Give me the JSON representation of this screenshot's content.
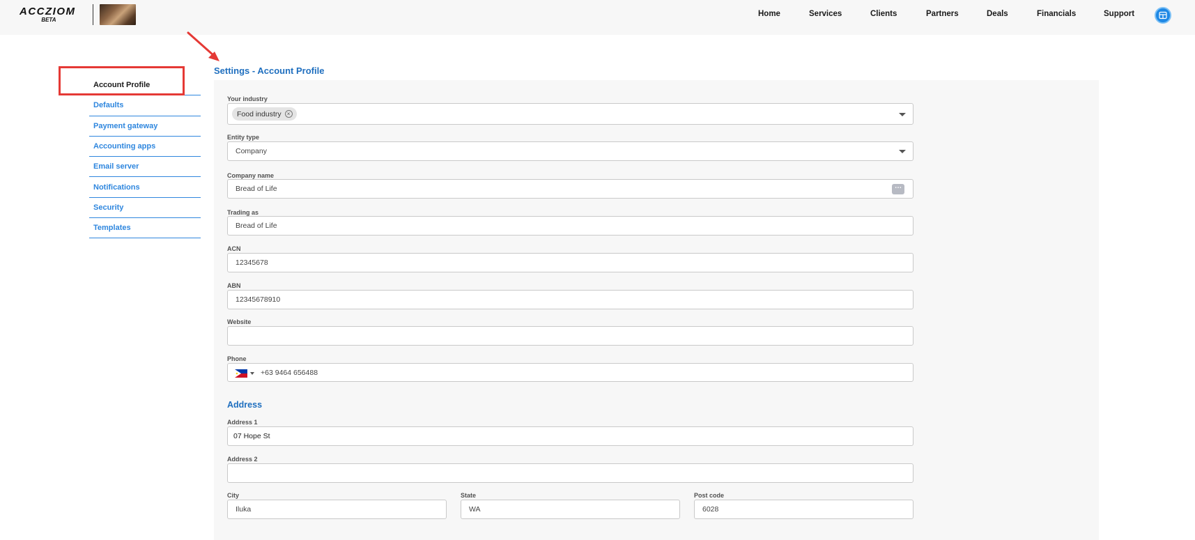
{
  "brand": {
    "name": "ACCZIOM",
    "badge": "BETA"
  },
  "nav": {
    "items": [
      "Home",
      "Services",
      "Clients",
      "Partners",
      "Deals",
      "Financials",
      "Support"
    ]
  },
  "sidebar": {
    "items": [
      {
        "label": "Account Profile",
        "active": true
      },
      {
        "label": "Defaults"
      },
      {
        "label": "Payment gateway"
      },
      {
        "label": "Accounting apps"
      },
      {
        "label": "Email server"
      },
      {
        "label": "Notifications"
      },
      {
        "label": "Security"
      },
      {
        "label": "Templates"
      }
    ]
  },
  "page": {
    "title": "Settings - Account Profile"
  },
  "form": {
    "industry": {
      "label": "Your industry",
      "chip": "Food industry"
    },
    "entity_type": {
      "label": "Entity type",
      "value": "Company"
    },
    "company_name": {
      "label": "Company name",
      "value": "Bread of Life",
      "action": "⋯"
    },
    "trading_as": {
      "label": "Trading as",
      "value": "Bread of Life"
    },
    "acn": {
      "label": "ACN",
      "value": "12345678"
    },
    "abn": {
      "label": "ABN",
      "value": "12345678910"
    },
    "website": {
      "label": "Website",
      "value": ""
    },
    "phone": {
      "label": "Phone",
      "value": "+63 9464 656488",
      "country_flag": "flag-philippines"
    }
  },
  "address": {
    "title": "Address",
    "address1": {
      "label": "Address 1",
      "value": "07 Hope St"
    },
    "address2": {
      "label": "Address 2",
      "value": ""
    },
    "city": {
      "label": "City",
      "value": "Iluka"
    },
    "state": {
      "label": "State",
      "value": "WA"
    },
    "postcode": {
      "label": "Post code",
      "value": "6028"
    }
  },
  "colors": {
    "accent": "#1f6fbf",
    "link": "#2e86de",
    "highlight": "#e53935"
  }
}
